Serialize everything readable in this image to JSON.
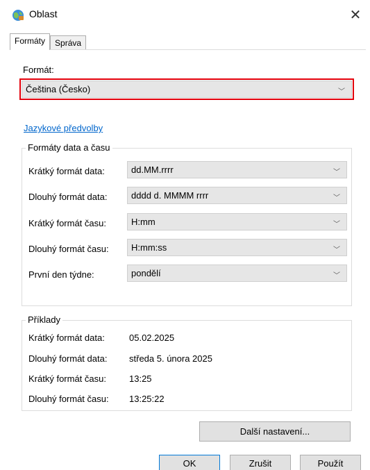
{
  "window": {
    "title": "Oblast"
  },
  "tabs": [
    {
      "label": "Formáty",
      "active": true
    },
    {
      "label": "Správa",
      "active": false
    }
  ],
  "format": {
    "label": "Formát:",
    "value": "Čeština (Česko)"
  },
  "language_link": "Jazykové předvolby",
  "date_time_formats": {
    "title": "Formáty data a času",
    "rows": [
      {
        "label": "Krátký formát data:",
        "value": "dd.MM.rrrr"
      },
      {
        "label": "Dlouhý formát data:",
        "value": "dddd d. MMMM rrrr"
      },
      {
        "label": "Krátký formát času:",
        "value": "H:mm"
      },
      {
        "label": "Dlouhý formát času:",
        "value": "H:mm:ss"
      },
      {
        "label": "První den týdne:",
        "value": "pondělí"
      }
    ]
  },
  "examples": {
    "title": "Příklady",
    "rows": [
      {
        "label": "Krátký formát data:",
        "value": "05.02.2025"
      },
      {
        "label": "Dlouhý formát data:",
        "value": "středa 5. února 2025"
      },
      {
        "label": "Krátký formát času:",
        "value": "13:25"
      },
      {
        "label": "Dlouhý formát času:",
        "value": "13:25:22"
      }
    ]
  },
  "buttons": {
    "additional": "Další nastavení...",
    "ok": "OK",
    "cancel": "Zrušit",
    "apply": "Použít"
  },
  "icons": {
    "title": "globe-icon",
    "close": "close-icon",
    "dropdown": "chevron-down-icon"
  },
  "colors": {
    "highlight": "#e3000b",
    "link": "#0066cc",
    "accent": "#0078d7"
  }
}
